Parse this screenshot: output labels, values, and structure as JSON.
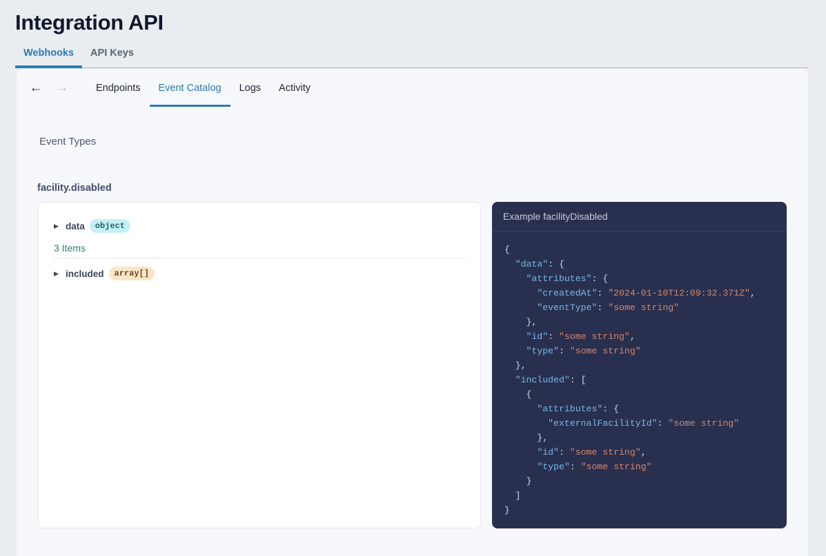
{
  "header": {
    "title": "Integration API",
    "tabs": [
      {
        "label": "Webhooks",
        "active": true
      },
      {
        "label": "API Keys",
        "active": false
      }
    ]
  },
  "subnav": {
    "back_icon": "arrow-left-icon",
    "back_glyph": "←",
    "forward_icon": "arrow-right-icon",
    "forward_glyph": "→",
    "tabs": [
      {
        "label": "Endpoints",
        "active": false
      },
      {
        "label": "Event Catalog",
        "active": true
      },
      {
        "label": "Logs",
        "active": false
      },
      {
        "label": "Activity",
        "active": false
      }
    ]
  },
  "content": {
    "section_title": "Event Types",
    "event_name": "facility.disabled",
    "schema": {
      "caret_glyph": "▶",
      "rows": [
        {
          "key": "data",
          "type": "object",
          "badge_style": "badge-object"
        },
        {
          "key": "included",
          "type": "array[]",
          "badge_style": "badge-array"
        }
      ],
      "items_count": "3 Items"
    },
    "code": {
      "header": "Example facilityDisabled",
      "lines": [
        [
          {
            "t": "pun",
            "v": "{"
          }
        ],
        [
          {
            "t": "pun",
            "v": "  "
          },
          {
            "t": "key",
            "v": "\"data\""
          },
          {
            "t": "pun",
            "v": ": {"
          }
        ],
        [
          {
            "t": "pun",
            "v": "    "
          },
          {
            "t": "key",
            "v": "\"attributes\""
          },
          {
            "t": "pun",
            "v": ": {"
          }
        ],
        [
          {
            "t": "pun",
            "v": "      "
          },
          {
            "t": "key",
            "v": "\"createdAt\""
          },
          {
            "t": "pun",
            "v": ": "
          },
          {
            "t": "str",
            "v": "\"2024-01-10T12:09:32.371Z\""
          },
          {
            "t": "pun",
            "v": ","
          }
        ],
        [
          {
            "t": "pun",
            "v": "      "
          },
          {
            "t": "key",
            "v": "\"eventType\""
          },
          {
            "t": "pun",
            "v": ": "
          },
          {
            "t": "str",
            "v": "\"some string\""
          }
        ],
        [
          {
            "t": "pun",
            "v": "    },"
          }
        ],
        [
          {
            "t": "pun",
            "v": "    "
          },
          {
            "t": "key",
            "v": "\"id\""
          },
          {
            "t": "pun",
            "v": ": "
          },
          {
            "t": "str",
            "v": "\"some string\""
          },
          {
            "t": "pun",
            "v": ","
          }
        ],
        [
          {
            "t": "pun",
            "v": "    "
          },
          {
            "t": "key",
            "v": "\"type\""
          },
          {
            "t": "pun",
            "v": ": "
          },
          {
            "t": "str",
            "v": "\"some string\""
          }
        ],
        [
          {
            "t": "pun",
            "v": "  },"
          }
        ],
        [
          {
            "t": "pun",
            "v": "  "
          },
          {
            "t": "key",
            "v": "\"included\""
          },
          {
            "t": "pun",
            "v": ": ["
          }
        ],
        [
          {
            "t": "pun",
            "v": "    {"
          }
        ],
        [
          {
            "t": "pun",
            "v": "      "
          },
          {
            "t": "key",
            "v": "\"attributes\""
          },
          {
            "t": "pun",
            "v": ": {"
          }
        ],
        [
          {
            "t": "pun",
            "v": "        "
          },
          {
            "t": "key",
            "v": "\"externalFacilityId\""
          },
          {
            "t": "pun",
            "v": ": "
          },
          {
            "t": "str",
            "v": "\"some string\""
          }
        ],
        [
          {
            "t": "pun",
            "v": "      },"
          }
        ],
        [
          {
            "t": "pun",
            "v": "      "
          },
          {
            "t": "key",
            "v": "\"id\""
          },
          {
            "t": "pun",
            "v": ": "
          },
          {
            "t": "str",
            "v": "\"some string\""
          },
          {
            "t": "pun",
            "v": ","
          }
        ],
        [
          {
            "t": "pun",
            "v": "      "
          },
          {
            "t": "key",
            "v": "\"type\""
          },
          {
            "t": "pun",
            "v": ": "
          },
          {
            "t": "str",
            "v": "\"some string\""
          }
        ],
        [
          {
            "t": "pun",
            "v": "    }"
          }
        ],
        [
          {
            "t": "pun",
            "v": "  ]"
          }
        ],
        [
          {
            "t": "pun",
            "v": "}"
          }
        ]
      ]
    }
  },
  "colors": {
    "page_background": "#e9edef",
    "card_background": "#f6f8fb",
    "accent_blue": "#2b7cb8",
    "title_dark": "#11182f",
    "code_background": "#292f4f",
    "code_key": "#79b8e8",
    "code_string": "#d4896b",
    "badge_object_bg": "#c5f1f6",
    "badge_array_bg": "#fbe5c8",
    "items_count_color": "#2e7d76"
  }
}
